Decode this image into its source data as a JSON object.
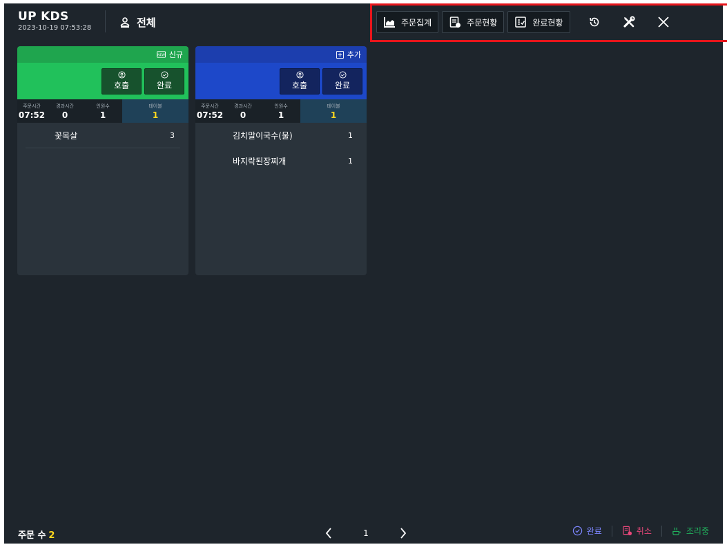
{
  "header": {
    "app_title": "UP KDS",
    "datetime": "2023-10-19 07:53:28",
    "store_label": "전체",
    "store_icon": "store-people-icon"
  },
  "toolbar": {
    "order_summary_label": "주문집계",
    "order_status_label": "주문현황",
    "complete_status_label": "완료현황",
    "history_icon": "history-icon",
    "settings_icon": "tools-icon",
    "close_icon": "close-icon",
    "highlight_color": "#e8151b"
  },
  "cards": [
    {
      "theme": "green",
      "badge_label": "신규",
      "badge_icon": "new-icon",
      "call_label": "호출",
      "complete_label": "완료",
      "stats": {
        "order_time_label": "주문시간",
        "order_time": "07:52",
        "elapsed_label": "경과시간",
        "elapsed": "0",
        "people_label": "인원수",
        "people": "1",
        "table_label": "테이블",
        "table": "1"
      },
      "items": [
        {
          "name": "꽃목살",
          "qty": "3"
        }
      ]
    },
    {
      "theme": "blue",
      "badge_label": "추가",
      "badge_icon": "add-icon",
      "call_label": "호출",
      "complete_label": "완료",
      "stats": {
        "order_time_label": "주문시간",
        "order_time": "07:52",
        "elapsed_label": "경과시간",
        "elapsed": "0",
        "people_label": "인원수",
        "people": "1",
        "table_label": "테이블",
        "table": "1"
      },
      "items": [
        {
          "name": "김치말이국수(물)",
          "qty": "1"
        },
        {
          "name": "바지락된장찌개",
          "qty": "1"
        }
      ]
    }
  ],
  "footer": {
    "order_count_label": "주문 수",
    "order_count": "2",
    "page": "1",
    "legend_complete": "완료",
    "legend_cancel": "취소",
    "legend_cooking": "조리중"
  },
  "colors": {
    "background": "#1e252c",
    "new_order": "#21c15b",
    "added_order": "#1d48c9",
    "accent_yellow": "#ffd81f"
  }
}
